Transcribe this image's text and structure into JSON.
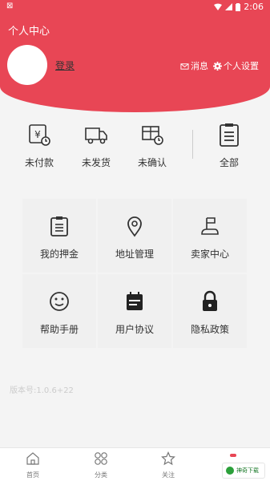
{
  "status": {
    "left": "⊠",
    "time": "2:06"
  },
  "header": {
    "title": "个人中心",
    "login": "登录",
    "message": "消息",
    "settings": "个人设置"
  },
  "orders": [
    {
      "label": "未付款",
      "icon": "unpaid-icon"
    },
    {
      "label": "未发货",
      "icon": "truck-icon"
    },
    {
      "label": "未确认",
      "icon": "confirm-icon"
    },
    {
      "label": "全部",
      "icon": "list-icon"
    }
  ],
  "grid": [
    {
      "label": "我的押金",
      "icon": "deposit-icon"
    },
    {
      "label": "地址管理",
      "icon": "location-icon"
    },
    {
      "label": "卖家中心",
      "icon": "flag-icon"
    },
    {
      "label": "帮助手册",
      "icon": "smile-icon"
    },
    {
      "label": "用户协议",
      "icon": "calendar-icon"
    },
    {
      "label": "隐私政策",
      "icon": "lock-icon"
    }
  ],
  "version": "版本号:1.0.6+22",
  "tabs": [
    {
      "label": "首页",
      "icon": "home-icon"
    },
    {
      "label": "分类",
      "icon": "category-icon"
    },
    {
      "label": "关注",
      "icon": "star-icon"
    }
  ],
  "watermark": "神奇下载",
  "colors": {
    "accent": "#e84655"
  }
}
